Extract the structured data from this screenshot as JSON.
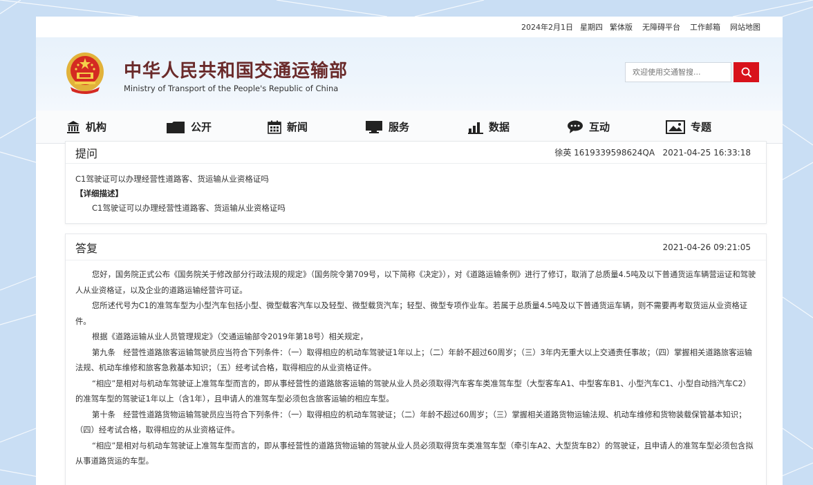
{
  "topbar": {
    "date": "2024年2月1日",
    "weekday": "星期四",
    "traditional": "繁体版",
    "accessible": "无障碍平台",
    "mail": "工作邮箱",
    "sitemap": "网站地图"
  },
  "header": {
    "title_cn": "中华人民共和国交通运输部",
    "title_en": "Ministry of Transport of the People's Republic of China"
  },
  "search": {
    "placeholder": "欢迎使用交通智搜..."
  },
  "nav": [
    {
      "label": "机构",
      "icon": "institution-icon"
    },
    {
      "label": "公开",
      "icon": "folder-icon"
    },
    {
      "label": "新闻",
      "icon": "calendar-icon"
    },
    {
      "label": "服务",
      "icon": "monitor-icon"
    },
    {
      "label": "数据",
      "icon": "bar-chart-icon"
    },
    {
      "label": "互动",
      "icon": "chat-icon"
    },
    {
      "label": "专题",
      "icon": "image-icon"
    }
  ],
  "question": {
    "heading": "提问",
    "author": "徐英 1619339598624QA",
    "time": "2021-04-25 16:33:18",
    "title": "C1驾驶证可以办理经营性道路客、货运输从业资格证吗",
    "detail_label": "【详细描述】",
    "detail": "C1驾驶证可以办理经营性道路客、货运输从业资格证吗"
  },
  "answer": {
    "heading": "答复",
    "time": "2021-04-26 09:21:05",
    "paragraphs": [
      "您好，国务院正式公布《国务院关于修改部分行政法规的规定》（国务院令第709号，以下简称《决定》），对《道路运输条例》进行了修订，取消了总质量4.5吨及以下普通货运车辆营运证和驾驶人从业资格证，以及企业的道路运输经营许可证。",
      "您所述代号为C1的准驾车型为小型汽车包括小型、微型载客汽车以及轻型、微型载货汽车；轻型、微型专项作业车。若属于总质量4.5吨及以下普通货运车辆，则不需要再考取货运从业资格证件。",
      "根据《道路运输从业人员管理规定》（交通运输部令2019年第18号）相关规定，",
      "第九条　经营性道路旅客运输驾驶员应当符合下列条件：（一）取得相应的机动车驾驶证1年以上；（二）年龄不超过60周岁；（三）3年内无重大以上交通责任事故；（四）掌握相关道路旅客运输法规、机动车维修和旅客急救基本知识；（五）经考试合格，取得相应的从业资格证件。",
      "“相应”是相对与机动车驾驶证上准驾车型而言的，即从事经营性的道路旅客运输的驾驶从业人员必须取得汽车客车类准驾车型（大型客车A1、中型客车B1、小型汽车C1、小型自动挡汽车C2）的准驾车型的驾驶证1年以上（含1年），且申请人的准驾车型必须包含旅客运输的相应车型。",
      "第十条　经营性道路货物运输驾驶员应当符合下列条件：（一）取得相应的机动车驾驶证；（二）年龄不超过60周岁；（三）掌握相关道路货物运输法规、机动车维修和货物装载保管基本知识；（四）经考试合格，取得相应的从业资格证件。",
      "“相应”是相对与机动车驾驶证上准驾车型而言的，即从事经营性的道路货物运输的驾驶从业人员必须取得货车类准驾车型（牵引车A2、大型货车B2）的驾驶证，且申请人的准驾车型必须包含拟从事道路货运的车型。"
    ]
  }
}
